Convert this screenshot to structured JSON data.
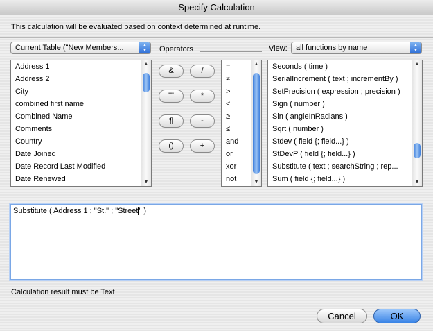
{
  "window": {
    "title": "Specify Calculation"
  },
  "description": "This calculation will be evaluated based on context determined at runtime.",
  "table_popup": {
    "value": "Current Table (\"New Members..."
  },
  "operators": {
    "label": "Operators",
    "buttons": [
      "&",
      "/",
      "\"\"",
      "*",
      "¶",
      "-",
      "()",
      "+"
    ],
    "list": [
      "=",
      "≠",
      ">",
      "<",
      "≥",
      "≤",
      "and",
      "or",
      "xor",
      "not"
    ]
  },
  "view": {
    "label": "View:",
    "value": "all functions by name"
  },
  "fields": [
    "Address 1",
    "Address 2",
    "City",
    "combined first name",
    "Combined Name",
    "Comments",
    "Country",
    "Date Joined",
    "Date Record Last Modified",
    "Date Renewed"
  ],
  "functions": [
    "Seconds ( time )",
    "SerialIncrement ( text ; incrementBy )",
    "SetPrecision ( expression ; precision )",
    "Sign ( number )",
    "Sin ( angleInRadians )",
    "Sqrt ( number )",
    "Stdev ( field {; field...} )",
    "StDevP ( field {; field...} )",
    "Substitute ( text ; searchString ; rep...",
    "Sum ( field {; field...} )"
  ],
  "formula": {
    "before_caret": "Substitute ( Address 1 ; \"St.\" ; \"Street",
    "after_caret": "\" )"
  },
  "result_type": "Calculation result must be Text",
  "buttons": {
    "cancel": "Cancel",
    "ok": "OK"
  }
}
